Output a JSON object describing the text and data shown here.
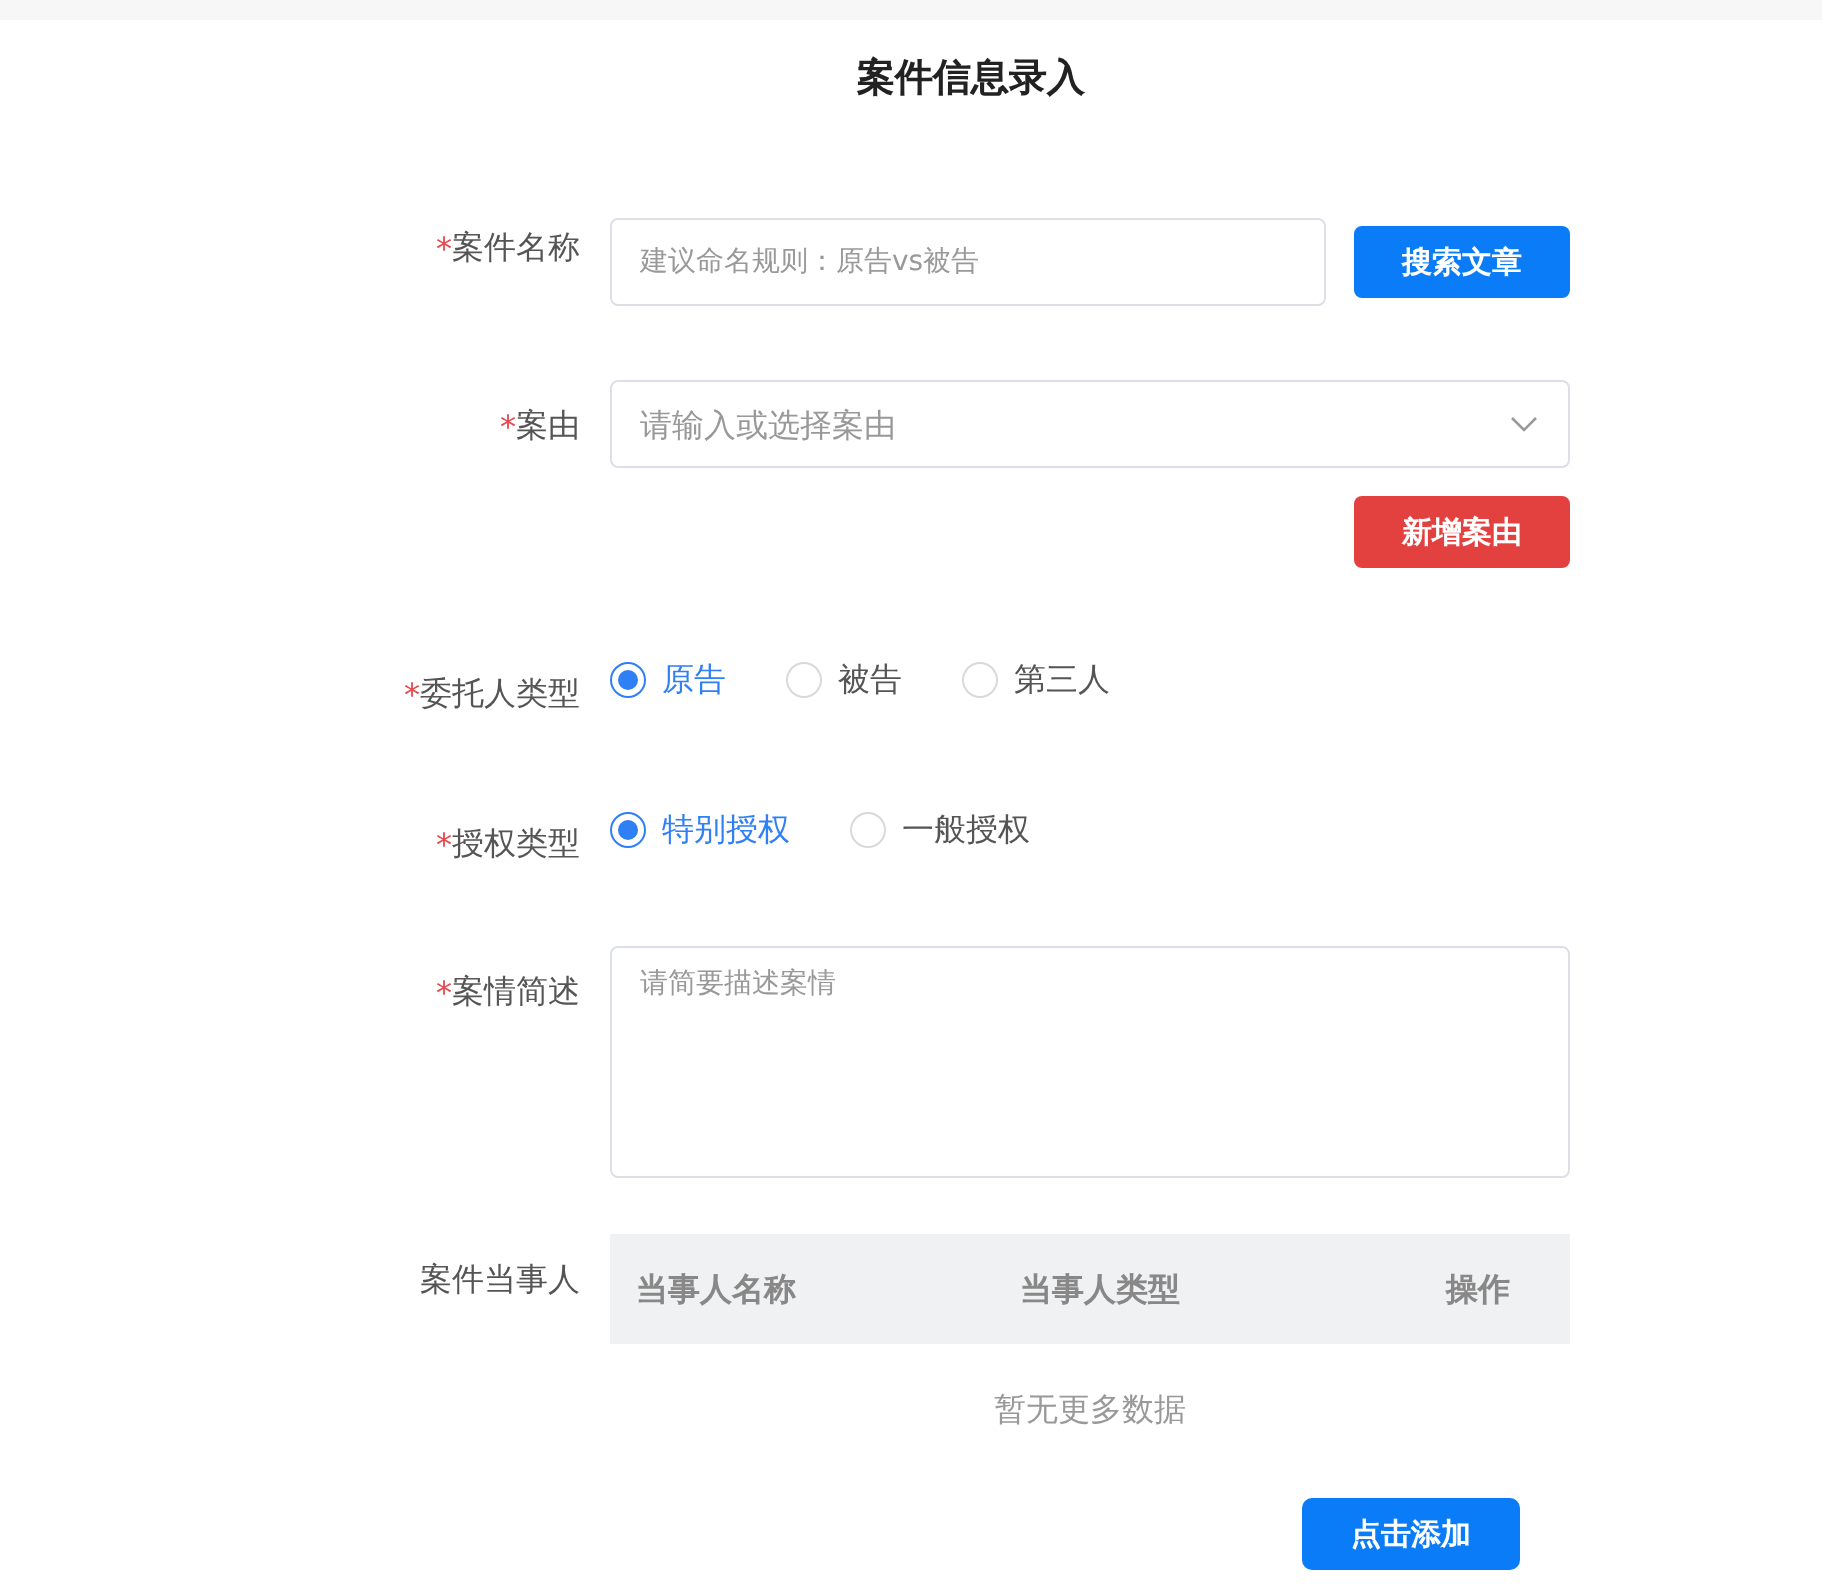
{
  "title": "案件信息录入",
  "fields": [
    {
      "kind": "text",
      "required": true,
      "mark": "*",
      "label": "案件名称",
      "placeholder": "建议命名规则：原告vs被告",
      "button": "搜索文章"
    },
    {
      "kind": "select",
      "required": true,
      "mark": "*",
      "label": "案由",
      "placeholder": "请输入或选择案由",
      "button": "新增案由"
    },
    {
      "kind": "radio",
      "required": true,
      "mark": "*",
      "label": "委托人类型",
      "options": [
        {
          "label": "原告",
          "selected": true
        },
        {
          "label": "被告",
          "selected": false
        },
        {
          "label": "第三人",
          "selected": false
        }
      ]
    },
    {
      "kind": "radio",
      "required": true,
      "mark": "*",
      "label": "授权类型",
      "options": [
        {
          "label": "特别授权",
          "selected": true
        },
        {
          "label": "一般授权",
          "selected": false
        }
      ]
    },
    {
      "kind": "textarea",
      "required": true,
      "mark": "*",
      "label": "案情简述",
      "placeholder": "请简要描述案情"
    },
    {
      "kind": "table",
      "required": false,
      "label": "案件当事人",
      "columns": [
        "当事人名称",
        "当事人类型",
        "操作"
      ],
      "empty_text": "暂无更多数据",
      "button": "点击添加"
    }
  ]
}
